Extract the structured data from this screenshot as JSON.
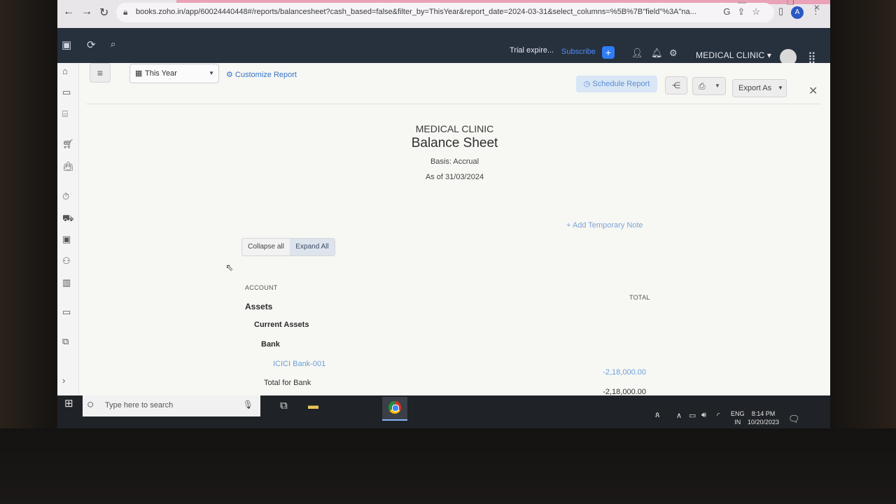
{
  "browser": {
    "url": "books.zoho.in/app/60024440448#/reports/balancesheet?cash_based=false&filter_by=ThisYear&report_date=2024-03-31&select_columns=%5B%7B\"field\"%3A\"na...",
    "profile_initial": "A"
  },
  "topbar": {
    "trial_text": "Trial expire...",
    "subscribe_label": "Subscribe",
    "org_name": "MEDICAL CLINIC"
  },
  "toolbar": {
    "period_label": "This Year",
    "customize_label": "Customize Report",
    "schedule_label": "Schedule Report",
    "export_label": "Export As"
  },
  "report": {
    "org": "MEDICAL CLINIC",
    "title": "Balance Sheet",
    "basis": "Basis: Accrual",
    "as_of": "As of 31/03/2024",
    "add_note_label": "+ Add Temporary Note",
    "collapse_label": "Collapse all",
    "expand_label": "Expand All",
    "col_account": "ACCOUNT",
    "col_total": "TOTAL",
    "rows": {
      "assets": "Assets",
      "current_assets": "Current Assets",
      "bank": "Bank",
      "icici": "ICICI Bank-001",
      "icici_amount": "-2,18,000.00",
      "total_bank": "Total for Bank",
      "total_bank_amount": "-2,18,000.00"
    }
  },
  "taskbar": {
    "search_placeholder": "Type here to search",
    "lang_top": "ENG",
    "lang_bottom": "IN",
    "time": "8:14 PM",
    "date": "10/20/2023"
  }
}
